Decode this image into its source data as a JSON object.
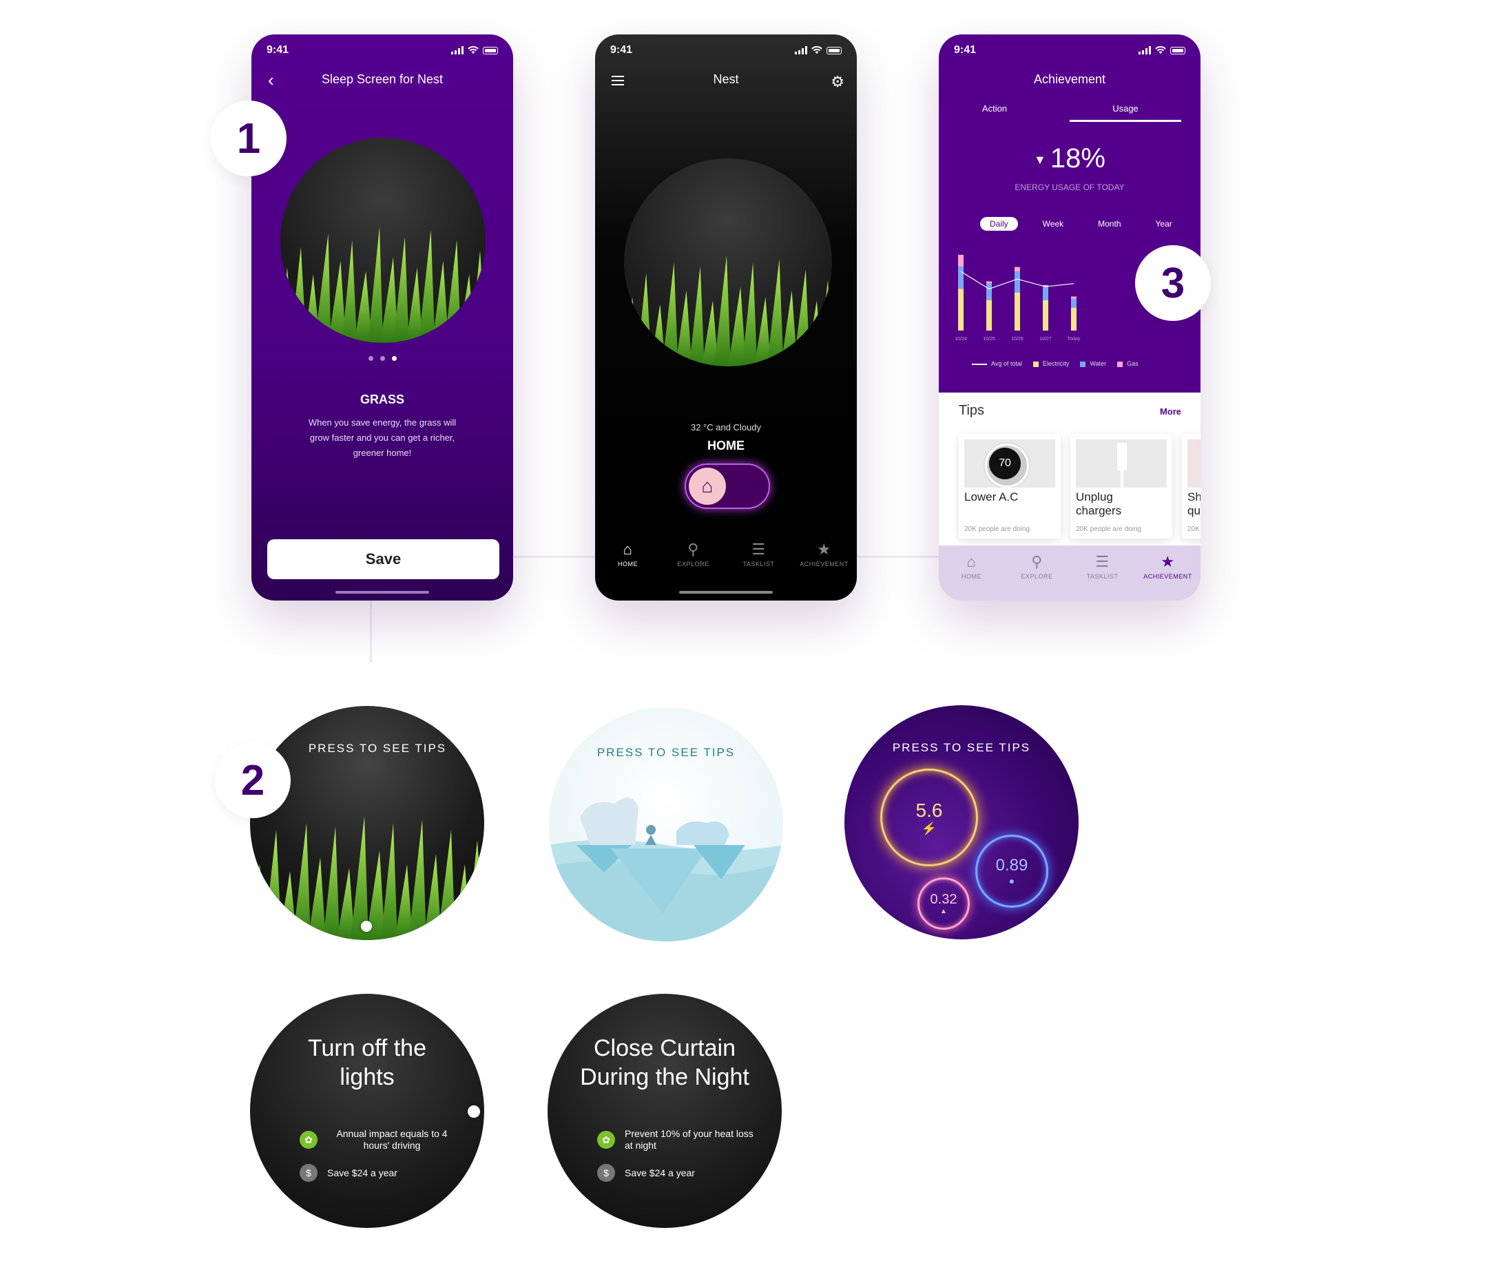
{
  "status": {
    "time": "9:41"
  },
  "screen1": {
    "title": "Sleep Screen for Nest",
    "grass_title": "GRASS",
    "grass_desc": "When you save energy, the grass will grow faster and you can get a richer, greener home!",
    "save_label": "Save"
  },
  "screen2": {
    "title": "Nest",
    "weather": "32 °C and Cloudy",
    "home_label": "HOME",
    "tabs": [
      {
        "label": "HOME",
        "icon": "home-icon"
      },
      {
        "label": "EXPLORE",
        "icon": "search-icon"
      },
      {
        "label": "TASKLIST",
        "icon": "list-icon"
      },
      {
        "label": "ACHIEVEMENT",
        "icon": "award-icon"
      }
    ]
  },
  "screen3": {
    "title": "Achievement",
    "tabs": [
      "Action",
      "Usage"
    ],
    "percent": "18%",
    "energy_sub": "ENERGY USAGE OF TODAY",
    "periods": [
      "Daily",
      "Week",
      "Month",
      "Year"
    ],
    "legend": [
      "Avg of total",
      "Electricity",
      "Water",
      "Gas"
    ],
    "tips_title": "Tips",
    "more_label": "More",
    "cards": [
      {
        "title": "Lower A.C",
        "sub": "20K people are doing",
        "dial": "70"
      },
      {
        "title": "Unplug chargers",
        "sub": "20K people are doing"
      },
      {
        "title": "Sh qu",
        "sub": "20K"
      }
    ],
    "tabs_bottom": [
      "HOME",
      "EXPLORE",
      "TASKLIST",
      "ACHIEVEMENT"
    ]
  },
  "chart_data": {
    "type": "bar",
    "categories": [
      "10/24",
      "10/25",
      "10/26",
      "10/27",
      "Today"
    ],
    "series": [
      {
        "name": "Electricity",
        "values": [
          55,
          40,
          50,
          40,
          30
        ]
      },
      {
        "name": "Water",
        "values": [
          30,
          22,
          28,
          18,
          12
        ]
      },
      {
        "name": "Gas",
        "values": [
          15,
          3,
          6,
          2,
          3
        ]
      }
    ],
    "avg_line": [
      78,
      55,
      68,
      58,
      62
    ],
    "colors": {
      "Electricity": "#f4e48a",
      "Water": "#7aa7f0",
      "Gas": "#f7a8c8",
      "avg": "#ffffff"
    }
  },
  "badges": [
    "1",
    "2",
    "3"
  ],
  "watch": {
    "press_label": "PRESS TO SEE TIPS",
    "readings": [
      "5.6",
      "0.89",
      "0.32"
    ],
    "tip1": {
      "title_line1": "Turn off the",
      "title_line2": "lights",
      "impact": "Annual impact equals to 4 hours' driving",
      "save": "Save $24 a year"
    },
    "tip2": {
      "title_line1": "Close Curtain",
      "title_line2": "During the Night",
      "impact": "Prevent 10% of your heat loss at night",
      "save": "Save $24 a year"
    }
  },
  "colors": {
    "purple": "#54008c",
    "dark": "#000000",
    "accent_glow": "#c25be0",
    "leaf_green": "#7cc22a"
  }
}
